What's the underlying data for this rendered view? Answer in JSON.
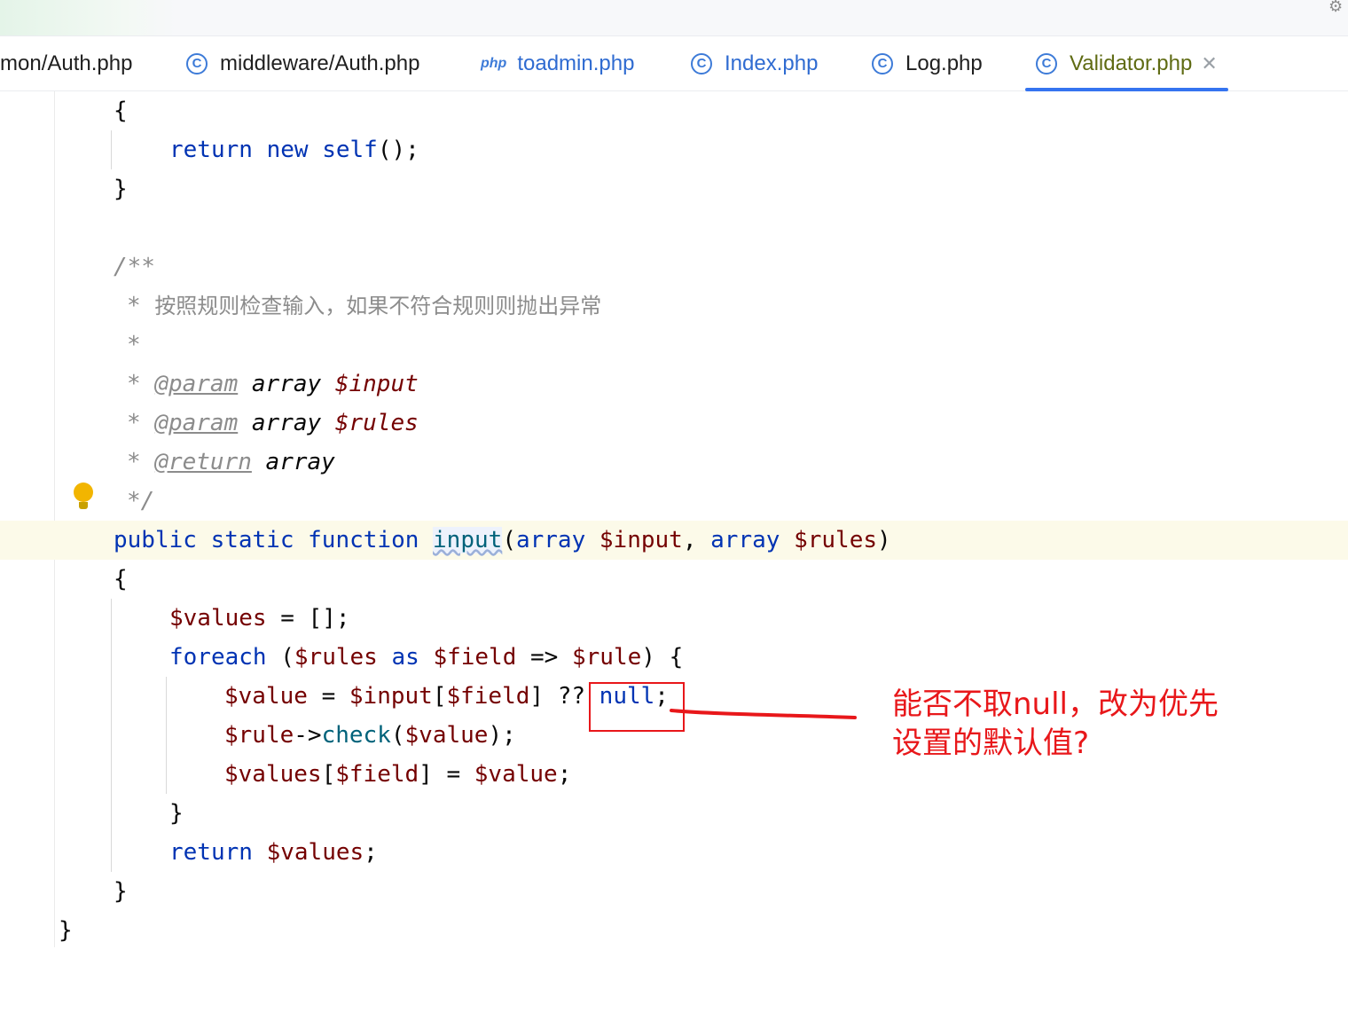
{
  "tabs": [
    {
      "label": "mon/Auth.php",
      "icon": "none"
    },
    {
      "label": "middleware/Auth.php",
      "icon": "class-icon"
    },
    {
      "label": "toadmin.php",
      "icon": "php-file-icon"
    },
    {
      "label": "Index.php",
      "icon": "class-icon"
    },
    {
      "label": "Log.php",
      "icon": "class-icon"
    },
    {
      "label": "Validator.php",
      "icon": "class-icon",
      "active": true,
      "close": "✕"
    }
  ],
  "code": {
    "l1": "{",
    "l2_kw1": "return",
    "l2_kw2": "new",
    "l2_kw3": "self",
    "l2_rest": "();",
    "l3": "}",
    "l5": "/**",
    "l6_star": "*",
    "l6_text": "按照规则检查输入，如果不符合规则则抛出异常",
    "l7": "*",
    "l8_star": "*",
    "l8_tag": "@param",
    "l8_type": "array",
    "l8_var": "$input",
    "l9_star": "*",
    "l9_tag": "@param",
    "l9_type": "array",
    "l9_var": "$rules",
    "l10_star": "*",
    "l10_tag": "@return",
    "l10_type": "array",
    "l11": "*/",
    "l12_kw": "public static function",
    "l12_fn": "input",
    "l12_p1": "(",
    "l12_t1": "array",
    "l12_v1": "$input",
    "l12_c": ",",
    "l12_t2": "array",
    "l12_v2": "$rules",
    "l12_p2": ")",
    "l13": "{",
    "l14_v": "$values",
    "l14_rest": " = [];",
    "l15_kw": "foreach",
    "l15_p1": " (",
    "l15_v1": "$rules",
    "l15_as": "as",
    "l15_v2": "$field",
    "l15_arrow": " => ",
    "l15_v3": "$rule",
    "l15_p2": ") {",
    "l16_v1": "$value",
    "l16_eq": " = ",
    "l16_v2": "$input",
    "l16_b1": "[",
    "l16_v3": "$field",
    "l16_b2": "] ?? ",
    "l16_null": "null",
    "l16_semi": ";",
    "l17_v1": "$rule",
    "l17_arrow": "->",
    "l17_fn": "check",
    "l17_p1": "(",
    "l17_v2": "$value",
    "l17_p2": ");",
    "l18_v1": "$values",
    "l18_b1": "[",
    "l18_v2": "$field",
    "l18_b2": "] = ",
    "l18_v3": "$value",
    "l18_semi": ";",
    "l19": "}",
    "l20_kw": "return",
    "l20_v": "$values",
    "l20_semi": ";",
    "l21": "}",
    "l22": "}"
  },
  "annotation": {
    "line1": "能否不取null，改为优先",
    "line2": "设置的默认值?",
    "color": "#e8171a"
  },
  "colors": {
    "keyword": "#0033b3",
    "variable": "#740000",
    "function": "#00627a",
    "comment": "#8c8c8c",
    "active_tab": "#5f6b13",
    "tab_underline": "#3574f0"
  }
}
